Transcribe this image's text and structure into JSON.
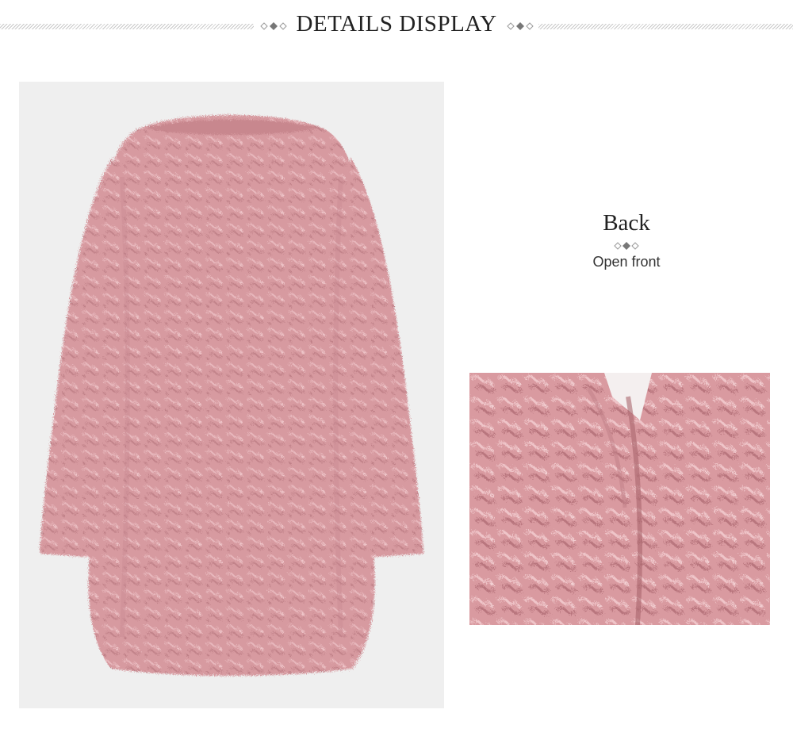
{
  "header": {
    "title": "DETAILS DISPLAY"
  },
  "main_view": {
    "caption_title": "Back",
    "caption_subtitle": "Open front"
  },
  "colors": {
    "coat_pink": "#d99aa0",
    "photo_background": "#efefef",
    "rule_gray": "#c8c8c8",
    "text_dark": "#222222"
  },
  "icons": {
    "section_ornament": "diamond-trio-icon"
  }
}
